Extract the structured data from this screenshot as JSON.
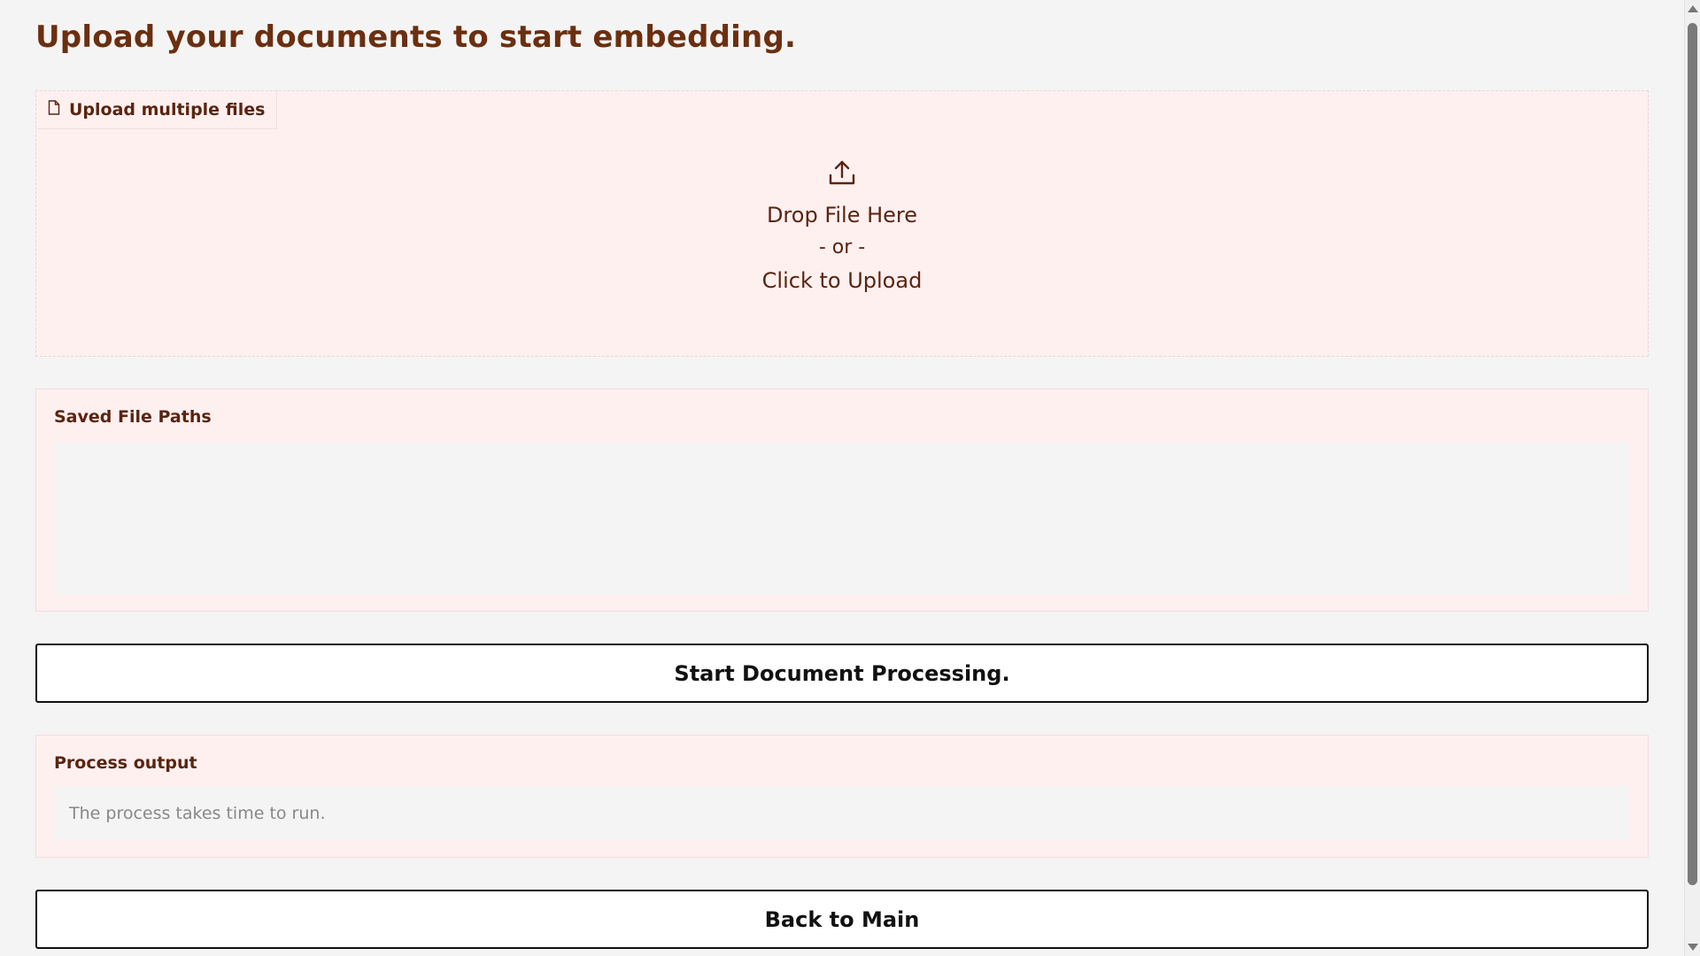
{
  "page": {
    "title": "Upload your documents to start embedding."
  },
  "upload": {
    "label": "Upload multiple files",
    "label_icon": "file-icon",
    "upload_icon": "upload-icon",
    "drop_text": "Drop File Here",
    "or_text": "- or -",
    "click_text": "Click to Upload"
  },
  "saved_paths": {
    "label": "Saved File Paths",
    "value": ""
  },
  "start_button": {
    "label": "Start Document Processing."
  },
  "output": {
    "label": "Process output",
    "placeholder": "The process takes time to run."
  },
  "back_button": {
    "label": "Back to Main"
  },
  "colors": {
    "accent": "#6b2f10",
    "panel_bg": "#fff0f0",
    "page_bg": "#f4f4f4"
  }
}
